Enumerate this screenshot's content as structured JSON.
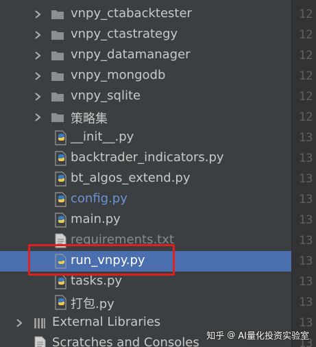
{
  "colors": {
    "panel_bg": "#3c3f41",
    "selection": "#4b6eaf",
    "folder": "#8c8f90",
    "python_blue": "#3d7ab8",
    "python_yellow": "#f2c94c",
    "highlight_box": "#e02020",
    "modified_file_blue": "#6a93d3"
  },
  "project_tree": {
    "items": [
      {
        "label": "vnpy_ctabacktester",
        "type": "folder",
        "icon": "folder-icon",
        "expandable": true,
        "state": "normal"
      },
      {
        "label": "vnpy_ctastrategy",
        "type": "folder",
        "icon": "folder-icon",
        "expandable": true,
        "state": "normal"
      },
      {
        "label": "vnpy_datamanager",
        "type": "folder",
        "icon": "folder-icon",
        "expandable": true,
        "state": "normal"
      },
      {
        "label": "vnpy_mongodb",
        "type": "folder",
        "icon": "folder-icon",
        "expandable": true,
        "state": "normal"
      },
      {
        "label": "vnpy_sqlite",
        "type": "folder",
        "icon": "folder-icon",
        "expandable": true,
        "state": "normal"
      },
      {
        "label": "策略集",
        "type": "folder",
        "icon": "folder-icon",
        "expandable": true,
        "state": "normal"
      },
      {
        "label": "__init__.py",
        "type": "python",
        "icon": "python-file-icon",
        "state": "normal"
      },
      {
        "label": "backtrader_indicators.py",
        "type": "python",
        "icon": "python-file-icon",
        "state": "normal"
      },
      {
        "label": "bt_algos_extend.py",
        "type": "python",
        "icon": "python-file-icon",
        "state": "normal"
      },
      {
        "label": "config.py",
        "type": "python",
        "icon": "python-file-icon",
        "state": "modified"
      },
      {
        "label": "main.py",
        "type": "python",
        "icon": "python-file-icon",
        "state": "normal"
      },
      {
        "label": "requirements.txt",
        "type": "text",
        "icon": "text-file-icon",
        "state": "normal"
      },
      {
        "label": "run_vnpy.py",
        "type": "python",
        "icon": "python-file-icon",
        "state": "selected"
      },
      {
        "label": "tasks.py",
        "type": "python",
        "icon": "python-file-icon",
        "state": "normal"
      },
      {
        "label": "打包.py",
        "type": "python",
        "icon": "python-file-icon",
        "state": "normal"
      }
    ],
    "external_libraries": "External Libraries",
    "scratches": "Scratches and Consoles"
  },
  "gutter": {
    "line_numbers": [
      "12",
      "12",
      "12",
      "12",
      "12",
      "12",
      "13",
      "13",
      "13",
      "13",
      "13",
      "13",
      "13",
      "13",
      "13",
      "13",
      "13"
    ]
  },
  "watermark": {
    "platform": "知乎",
    "at": "@",
    "account": "AI量化投资实验室"
  }
}
